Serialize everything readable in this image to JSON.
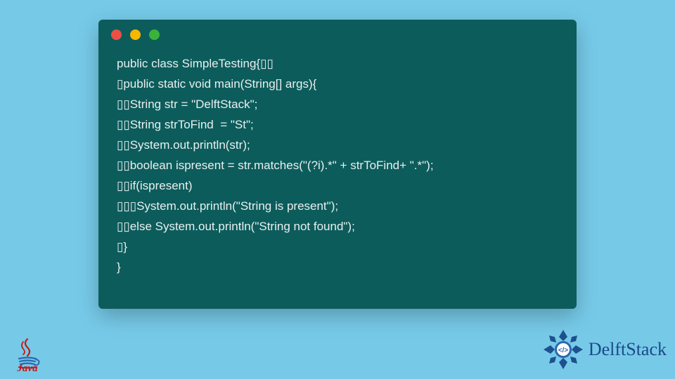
{
  "code": {
    "lines": [
      "public class SimpleTesting{▯▯",
      "▯public static void main(String[] args){",
      "▯▯String str = \"DelftStack\";",
      "▯▯String strToFind  = \"St\";",
      "▯▯System.out.println(str);",
      "▯▯boolean ispresent = str.matches(\"(?i).*\" + strToFind+ \".*\");",
      "▯▯if(ispresent)",
      "▯▯▯System.out.println(\"String is present\");",
      "▯▯else System.out.println(\"String not found\");",
      "▯}",
      "}"
    ]
  },
  "logos": {
    "java_label": "Java",
    "delft_label": "DelftStack"
  },
  "colors": {
    "bg": "#76cae8",
    "window": "#0d5c5c",
    "text": "#e8f0ef",
    "java_red": "#c91818",
    "delft_blue": "#1a4a8a"
  }
}
